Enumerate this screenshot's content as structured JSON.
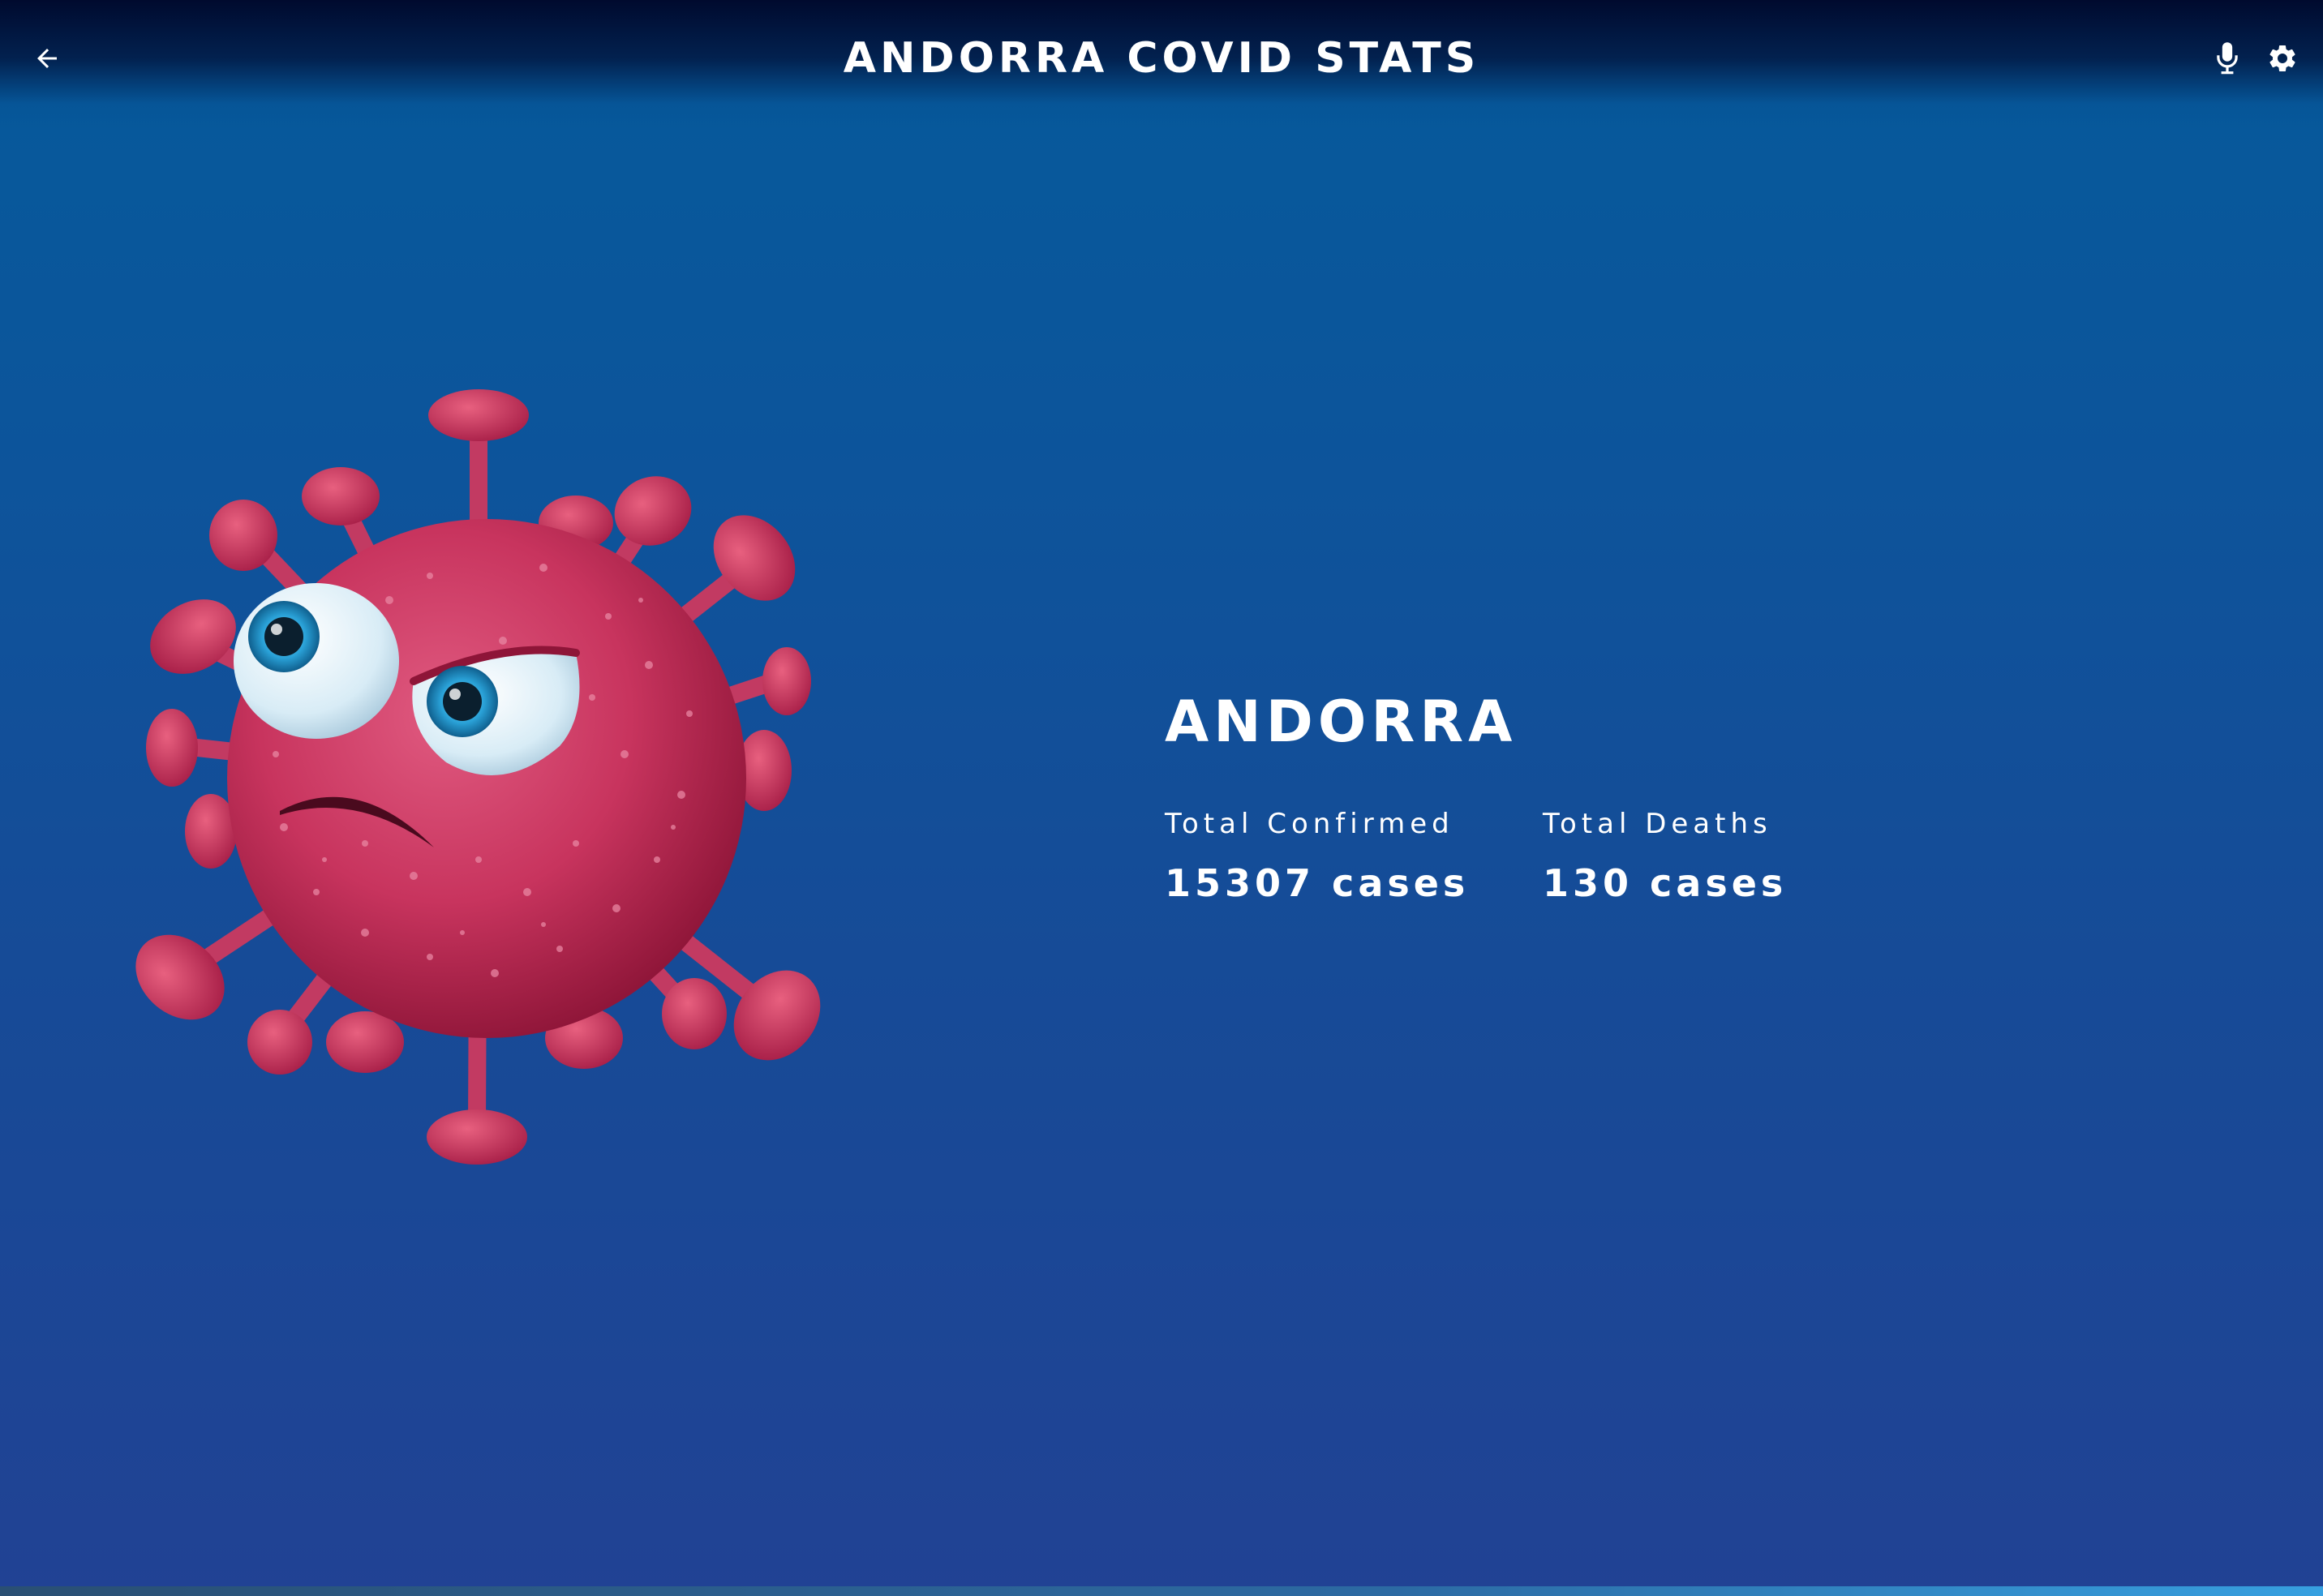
{
  "header": {
    "title": "ANDORRA COVID STATS",
    "back_icon": "arrow-left-icon",
    "mic_icon": "microphone-icon",
    "settings_icon": "gear-icon"
  },
  "country": {
    "name": "ANDORRA"
  },
  "stats": {
    "confirmed": {
      "label": "Total Confirmed",
      "value": "15307 cases"
    },
    "deaths": {
      "label": "Total Deaths",
      "value": "130 cases"
    }
  },
  "illustration": {
    "name": "angry-virus-mascot",
    "colors": {
      "body": "#c8345e",
      "body_dark": "#8e1538",
      "eye_white": "#d8ecf6",
      "iris": "#2aa2d8",
      "pupil": "#0b1f2e"
    }
  },
  "colors": {
    "background_top": "#055a9b",
    "background_bottom": "#214294",
    "header": "#000a2e",
    "text": "#ffffff"
  }
}
